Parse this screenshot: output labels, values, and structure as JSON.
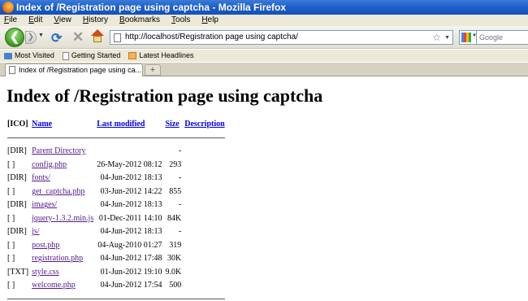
{
  "window": {
    "title": "Index of /Registration page using captcha - Mozilla Firefox"
  },
  "menu": [
    "File",
    "Edit",
    "View",
    "History",
    "Bookmarks",
    "Tools",
    "Help"
  ],
  "navbar": {
    "url": "http://localhost/Registration page using captcha/",
    "search_placeholder": "Google"
  },
  "bookmarks": [
    "Most Visited",
    "Getting Started",
    "Latest Headlines"
  ],
  "tab": {
    "title": "Index of /Registration page using ca...",
    "new_tab_label": "+"
  },
  "page": {
    "heading": "Index of /Registration page using captcha",
    "columns": {
      "icon": "[ICO]",
      "name": "Name",
      "modified": "Last modified",
      "size": "Size",
      "description": "Description"
    },
    "rows": [
      {
        "icon": "[DIR]",
        "name": "Parent Directory",
        "modified": "",
        "size": "-"
      },
      {
        "icon": "[ ]",
        "name": "config.php",
        "modified": "26-May-2012 08:12",
        "size": "293"
      },
      {
        "icon": "[DIR]",
        "name": "fonts/",
        "modified": "04-Jun-2012 18:13",
        "size": "-"
      },
      {
        "icon": "[ ]",
        "name": "get_captcha.php",
        "modified": "03-Jun-2012 14:22",
        "size": "855"
      },
      {
        "icon": "[DIR]",
        "name": "images/",
        "modified": "04-Jun-2012 18:13",
        "size": "-"
      },
      {
        "icon": "[ ]",
        "name": "jquery-1.3.2.min.js",
        "modified": "01-Dec-2011 14:10",
        "size": "84K"
      },
      {
        "icon": "[DIR]",
        "name": "js/",
        "modified": "04-Jun-2012 18:13",
        "size": "-"
      },
      {
        "icon": "[ ]",
        "name": "post.php",
        "modified": "04-Aug-2010 01:27",
        "size": "319"
      },
      {
        "icon": "[ ]",
        "name": "registration.php",
        "modified": "04-Jun-2012 17:48",
        "size": "30K"
      },
      {
        "icon": "[TXT]",
        "name": "style.css",
        "modified": "01-Jun-2012 19:10",
        "size": "9.0K"
      },
      {
        "icon": "[ ]",
        "name": "welcome.php",
        "modified": "04-Jun-2012 17:54",
        "size": "500"
      }
    ]
  },
  "colors": {
    "titlebar": "#1c5ec8",
    "link": "#0000ee",
    "visited_link": "#551a8b",
    "chrome": "#ece9d8"
  }
}
